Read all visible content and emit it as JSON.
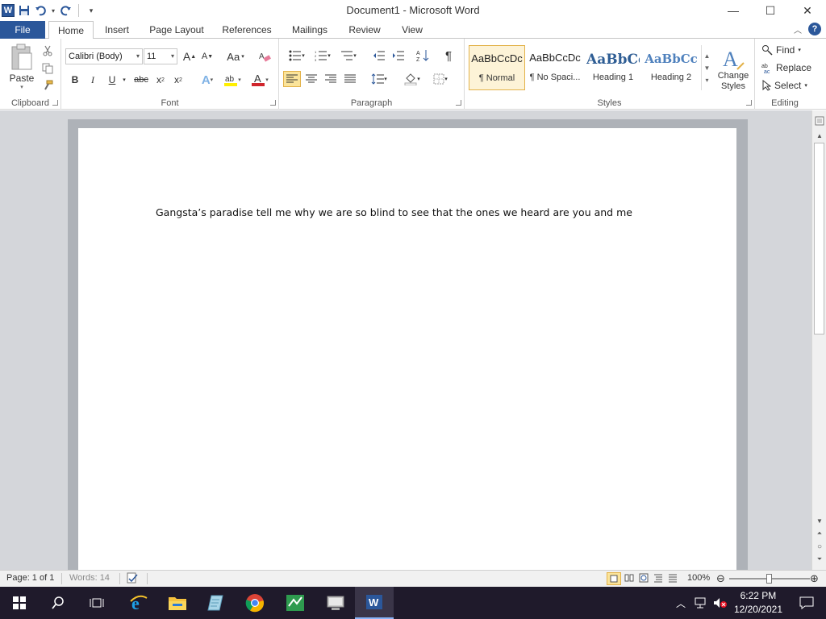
{
  "window": {
    "title": "Document1 - Microsoft Word",
    "app_icon_letter": "W",
    "controls": {
      "minimize": "—",
      "maximize": "☐",
      "close": "✕"
    }
  },
  "qat": {
    "undo_icon": "undo-icon",
    "redo_icon": "redo-icon",
    "save_icon": "save-icon"
  },
  "tabs": {
    "file": "File",
    "items": [
      "Home",
      "Insert",
      "Page Layout",
      "References",
      "Mailings",
      "Review",
      "View"
    ],
    "active": "Home"
  },
  "ribbon": {
    "clipboard": {
      "label": "Clipboard",
      "paste": "Paste"
    },
    "font": {
      "label": "Font",
      "family": "Calibri (Body)",
      "size": "11",
      "grow": "A",
      "shrink": "A",
      "case": "Aa",
      "bold": "B",
      "italic": "I",
      "underline": "U",
      "strike": "abc",
      "subscript": "x",
      "superscript": "x",
      "font_color_letter": "A",
      "font_color": "#d0252c",
      "highlight_color": "#ffef00"
    },
    "paragraph": {
      "label": "Paragraph",
      "pilcrow": "¶"
    },
    "styles": {
      "label": "Styles",
      "items": [
        {
          "sample": "AaBbCcDc",
          "name": "¶ Normal"
        },
        {
          "sample": "AaBbCcDc",
          "name": "¶ No Spaci..."
        },
        {
          "sample": "AaBbCc",
          "name": "Heading 1"
        },
        {
          "sample": "AaBbCc",
          "name": "Heading 2"
        }
      ],
      "change_styles": "Change Styles"
    },
    "editing": {
      "label": "Editing",
      "find": "Find",
      "replace": "Replace",
      "select": "Select"
    }
  },
  "document": {
    "text": "Gangsta’s paradise tell me why we are so blind to see that the ones we heard are you and me"
  },
  "statusbar": {
    "page": "Page: 1 of 1",
    "words": "Words: 14",
    "zoom": "100%"
  },
  "taskbar": {
    "time": "6:22 PM",
    "date": "12/20/2021"
  },
  "colors": {
    "accent": "#2b579a",
    "taskbar": "#1f1a2b",
    "doc_background": "#d4d6da"
  }
}
